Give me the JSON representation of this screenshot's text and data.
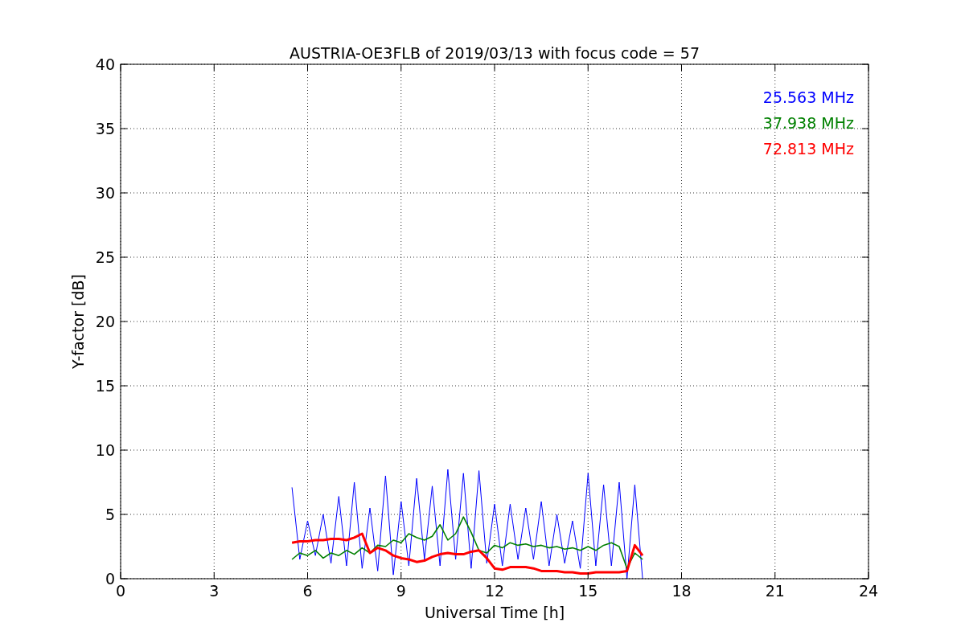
{
  "chart_data": {
    "type": "line",
    "title": "AUSTRIA-OE3FLB of 2019/03/13 with focus code = 57",
    "xlabel": "Universal Time [h]",
    "ylabel": "Y-factor [dB]",
    "x": [
      5.5,
      5.75,
      6,
      6.25,
      6.5,
      6.75,
      7,
      7.25,
      7.5,
      7.75,
      8,
      8.25,
      8.5,
      8.75,
      9,
      9.25,
      9.5,
      9.75,
      10,
      10.25,
      10.5,
      10.75,
      11,
      11.25,
      11.5,
      11.75,
      12,
      12.25,
      12.5,
      12.75,
      13,
      13.25,
      13.5,
      13.75,
      14,
      14.25,
      14.5,
      14.75,
      15,
      15.25,
      15.5,
      15.75,
      16,
      16.25,
      16.5,
      16.75
    ],
    "series": [
      {
        "name": "25.563 MHz",
        "color": "#0000ff",
        "values": [
          7.1,
          1.5,
          4.5,
          1.8,
          5.0,
          1.2,
          6.4,
          1.0,
          7.5,
          0.8,
          5.5,
          0.6,
          8.0,
          0.3,
          6.0,
          1.0,
          7.8,
          1.5,
          7.2,
          1.0,
          8.5,
          1.5,
          8.2,
          0.8,
          8.4,
          1.2,
          5.8,
          1.0,
          5.8,
          1.5,
          5.5,
          1.5,
          6.0,
          1.0,
          5.0,
          1.2,
          4.5,
          0.8,
          8.2,
          1.0,
          7.3,
          1.0,
          7.5,
          0.0,
          7.3,
          0.0
        ]
      },
      {
        "name": "37.938 MHz",
        "color": "#008000",
        "values": [
          1.5,
          2.0,
          1.8,
          2.2,
          1.6,
          2.0,
          1.8,
          2.2,
          1.9,
          2.4,
          2.0,
          2.6,
          2.5,
          3.0,
          2.8,
          3.5,
          3.2,
          3.0,
          3.3,
          4.2,
          3.0,
          3.5,
          4.8,
          3.6,
          2.2,
          2.0,
          2.6,
          2.4,
          2.8,
          2.6,
          2.7,
          2.5,
          2.6,
          2.4,
          2.5,
          2.3,
          2.4,
          2.2,
          2.5,
          2.2,
          2.6,
          2.8,
          2.5,
          0.8,
          2.0,
          1.5
        ]
      },
      {
        "name": "72.813 MHz",
        "color": "#ff0000",
        "values": [
          2.8,
          2.9,
          2.9,
          3.0,
          3.0,
          3.1,
          3.1,
          3.0,
          3.2,
          3.5,
          2.0,
          2.4,
          2.2,
          1.8,
          1.6,
          1.5,
          1.3,
          1.4,
          1.7,
          1.9,
          2.0,
          1.9,
          1.9,
          2.1,
          2.2,
          1.6,
          0.8,
          0.7,
          0.9,
          0.9,
          0.9,
          0.8,
          0.6,
          0.6,
          0.6,
          0.5,
          0.5,
          0.4,
          0.4,
          0.5,
          0.5,
          0.5,
          0.5,
          0.6,
          2.6,
          1.8
        ]
      }
    ],
    "xlim": [
      0,
      24
    ],
    "ylim": [
      0,
      40
    ],
    "xticks": [
      0,
      3,
      6,
      9,
      12,
      15,
      18,
      21,
      24
    ],
    "yticks": [
      0,
      5,
      10,
      15,
      20,
      25,
      30,
      35,
      40
    ],
    "grid": true
  }
}
